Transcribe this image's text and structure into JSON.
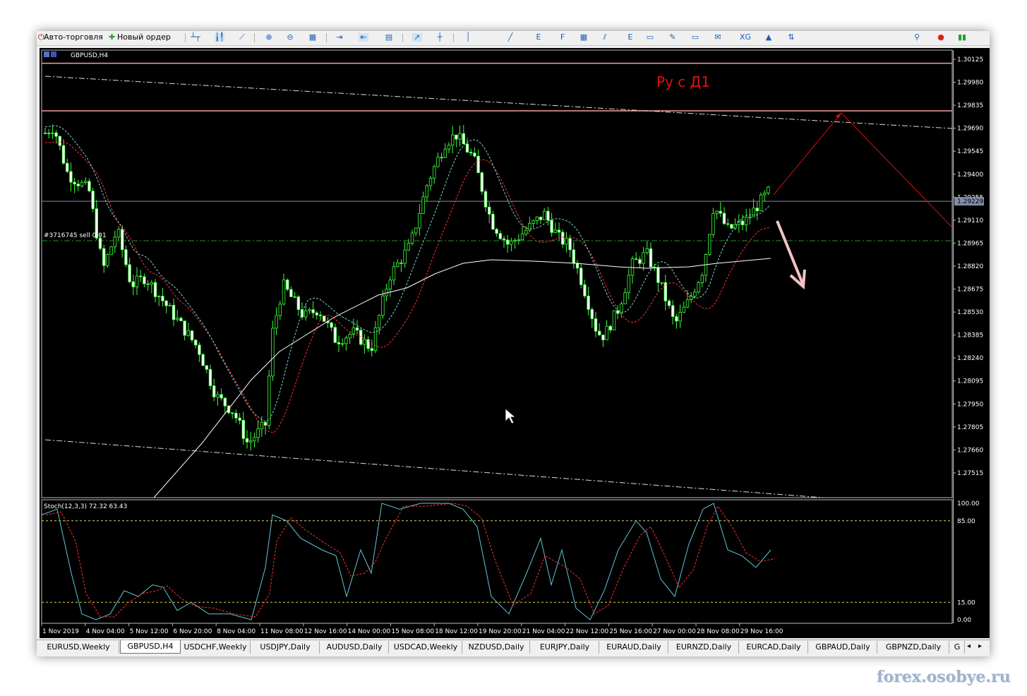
{
  "toolbar": {
    "autotrading_label": "Авто-торговля",
    "new_order_label": "Новый ордер"
  },
  "chart": {
    "title": "GBPUSD,H4",
    "annotation": "Ру  с Д1",
    "order_label": "#3716745 sell 0.01",
    "current_price": "1.29229",
    "price_axis": [
      "1.30125",
      "1.29980",
      "1.29835",
      "1.29690",
      "1.29545",
      "1.29400",
      "1.29255",
      "1.29110",
      "1.28965",
      "1.28820",
      "1.28675",
      "1.28530",
      "1.28385",
      "1.28240",
      "1.28095",
      "1.27950",
      "1.27805",
      "1.27660",
      "1.27515"
    ],
    "time_axis": [
      "1 Nov 2019",
      "4 Nov 04:00",
      "5 Nov 12:00",
      "6 Nov 20:00",
      "8 Nov 04:00",
      "11 Nov 08:00",
      "12 Nov 16:00",
      "14 Nov 00:00",
      "15 Nov 08:00",
      "18 Nov 12:00",
      "19 Nov 20:00",
      "21 Nov 04:00",
      "22 Nov 12:00",
      "25 Nov 16:00",
      "27 Nov 00:00",
      "28 Nov 08:00",
      "29 Nov 16:00"
    ],
    "horizontal_lines": {
      "resistance_top": "1.30100",
      "resistance": "1.29800",
      "order_line": "1.28980",
      "bid": "1.29229"
    },
    "colors": {
      "bull": "#3cff3c",
      "bear": "#ffffff",
      "ma_fast": "#ff3030",
      "ma_mid": "#7fd4d4",
      "ma_slow": "#ffffff",
      "annotation": "#e01010",
      "arrow_down": "#f4c2c2",
      "arrow_up": "#cc1111"
    }
  },
  "stochastic": {
    "label": "Stoch(12,3,3) 72.32 63.43",
    "levels": [
      "100.00",
      "85.00",
      "15.00",
      "0.00"
    ]
  },
  "tabs": [
    {
      "label": "EURUSD,Weekly",
      "active": false
    },
    {
      "label": "GBPUSD,H4",
      "active": true
    },
    {
      "label": "USDCHF,Weekly",
      "active": false
    },
    {
      "label": "USDJPY,Daily",
      "active": false
    },
    {
      "label": "AUDUSD,Daily",
      "active": false
    },
    {
      "label": "USDCAD,Weekly",
      "active": false
    },
    {
      "label": "NZDUSD,Daily",
      "active": false
    },
    {
      "label": "EURJPY,Daily",
      "active": false
    },
    {
      "label": "EURAUD,Daily",
      "active": false
    },
    {
      "label": "EURNZD,Daily",
      "active": false
    },
    {
      "label": "EURCAD,Daily",
      "active": false
    },
    {
      "label": "GBPAUD,Daily",
      "active": false
    },
    {
      "label": "GBPNZD,Daily",
      "active": false
    },
    {
      "label": "G",
      "active": false
    }
  ],
  "watermark": "forex.osobye.ru"
}
